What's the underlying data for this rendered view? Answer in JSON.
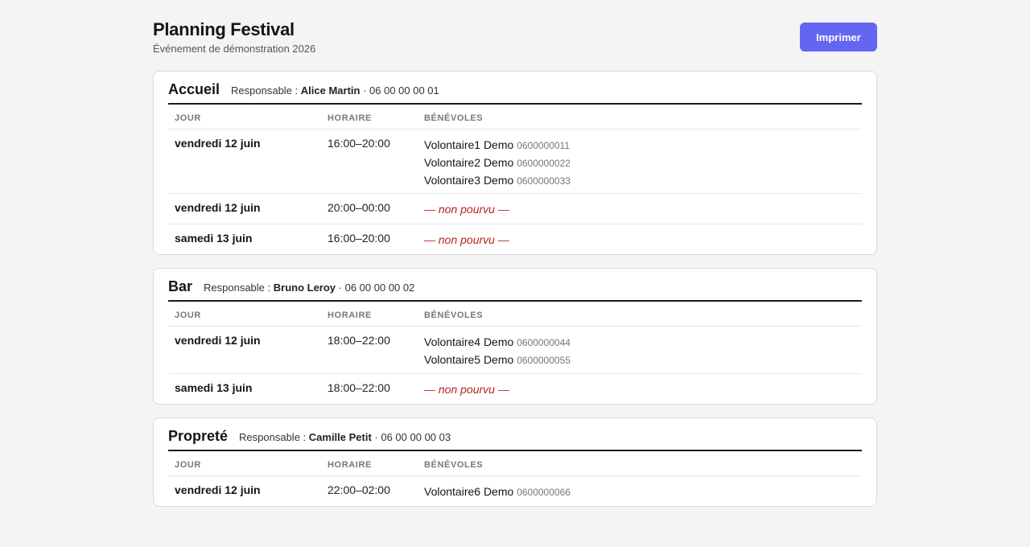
{
  "header": {
    "title": "Planning Festival",
    "subtitle": "Événement de démonstration 2026",
    "print_label": "Imprimer"
  },
  "columns": {
    "day": "JOUR",
    "time": "HORAIRE",
    "volunteers": "BÉNÉVOLES"
  },
  "labels": {
    "responsable_prefix": "Responsable : ",
    "separator": " · ",
    "unfilled": "— non pourvu —"
  },
  "sections": [
    {
      "name": "Accueil",
      "manager": "Alice Martin",
      "manager_phone": "06 00 00 00 01",
      "rows": [
        {
          "day": "vendredi 12 juin",
          "time": "16:00–20:00",
          "volunteers": [
            {
              "name": "Volontaire1 Demo",
              "phone": "0600000011"
            },
            {
              "name": "Volontaire2 Demo",
              "phone": "0600000022"
            },
            {
              "name": "Volontaire3 Demo",
              "phone": "0600000033"
            }
          ]
        },
        {
          "day": "vendredi 12 juin",
          "time": "20:00–00:00",
          "volunteers": []
        },
        {
          "day": "samedi 13 juin",
          "time": "16:00–20:00",
          "volunteers": []
        }
      ]
    },
    {
      "name": "Bar",
      "manager": "Bruno Leroy",
      "manager_phone": "06 00 00 00 02",
      "rows": [
        {
          "day": "vendredi 12 juin",
          "time": "18:00–22:00",
          "volunteers": [
            {
              "name": "Volontaire4 Demo",
              "phone": "0600000044"
            },
            {
              "name": "Volontaire5 Demo",
              "phone": "0600000055"
            }
          ]
        },
        {
          "day": "samedi 13 juin",
          "time": "18:00–22:00",
          "volunteers": []
        }
      ]
    },
    {
      "name": "Propreté",
      "manager": "Camille Petit",
      "manager_phone": "06 00 00 00 03",
      "rows": [
        {
          "day": "vendredi 12 juin",
          "time": "22:00–02:00",
          "volunteers": [
            {
              "name": "Volontaire6 Demo",
              "phone": "0600000066"
            }
          ]
        }
      ]
    }
  ]
}
